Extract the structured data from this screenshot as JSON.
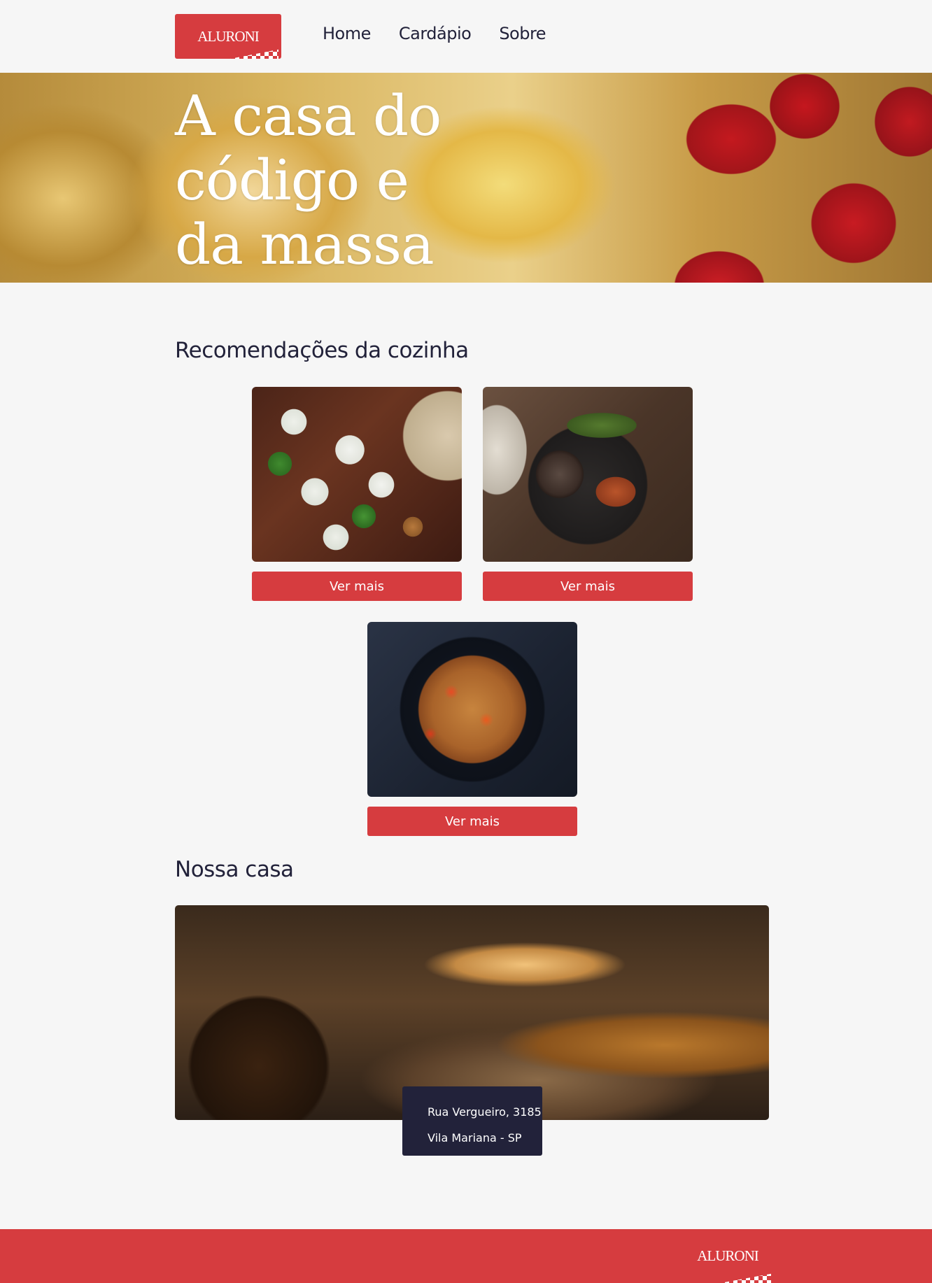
{
  "brand": {
    "logo_text": "ALURONI",
    "primary_color": "#d63c3f",
    "dark_color": "#22223a",
    "background_color": "#f6f6f6"
  },
  "nav": {
    "items": [
      {
        "label": "Home"
      },
      {
        "label": "Cardápio"
      },
      {
        "label": "Sobre"
      }
    ]
  },
  "hero": {
    "title_line_1": "A casa do",
    "title_line_2": "código e",
    "title_line_3": "da massa"
  },
  "recommendations": {
    "title": "Recomendações da cozinha",
    "items": [
      {
        "button_label": "Ver mais"
      },
      {
        "button_label": "Ver mais"
      },
      {
        "button_label": "Ver mais"
      }
    ]
  },
  "casa": {
    "title": "Nossa casa",
    "address_line_1": "Rua Vergueiro, 3185",
    "address_line_2": "Vila Mariana - SP"
  },
  "footer": {
    "logo_text": "ALURONI"
  }
}
